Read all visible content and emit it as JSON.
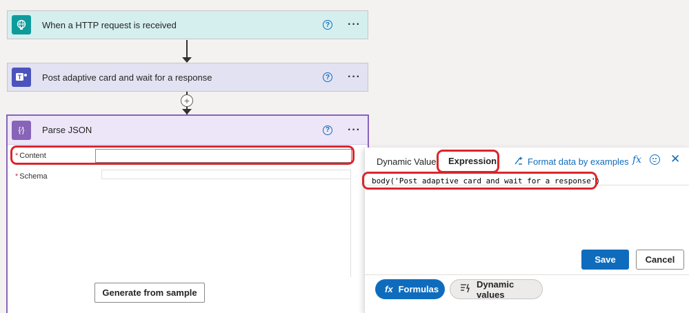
{
  "flow": {
    "trigger": {
      "title": "When a HTTP request is received"
    },
    "teams_action": {
      "title": "Post adaptive card and wait for a response"
    },
    "parse_json": {
      "title": "Parse JSON",
      "content_label": "Content",
      "schema_label": "Schema",
      "required_marker": "*",
      "generate_button": "Generate from sample"
    },
    "help_glyph": "?",
    "more_glyph": "···",
    "plus_glyph": "+"
  },
  "panel": {
    "tabs": {
      "dynamic": "Dynamic Value",
      "expression": "Expression"
    },
    "format_link": "Format data by examples",
    "fx_glyph": "fx",
    "close_glyph": "✕",
    "expression_value": "body('Post adaptive card and wait for a response')",
    "save": "Save",
    "cancel": "Cancel",
    "formulas_pill": "Formulas",
    "dynamic_values_pill": "Dynamic values"
  },
  "colors": {
    "accent": "#0f6cbd",
    "highlight_red": "#d9262b",
    "parse_purple": "#8764b8",
    "teams_purple": "#4b53bc",
    "http_teal": "#0f9b9b"
  }
}
